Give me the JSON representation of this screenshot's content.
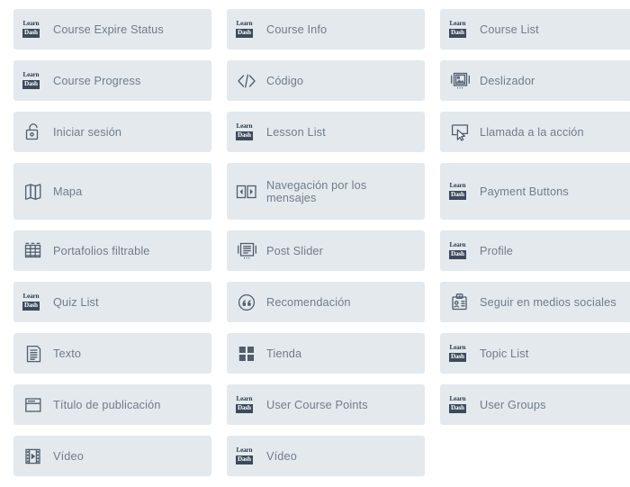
{
  "palette": {
    "page_background": "#ffffff",
    "card_background": "#e3e9ed",
    "label_color": "#6f7d8c",
    "icon_color": "#4f5d6e",
    "learndash_badge": "#3c4a5c"
  },
  "widgets": [
    [
      {
        "label": "Course Expire Status",
        "icon": "learndash-logo-icon",
        "tall": false
      },
      {
        "label": "Course Info",
        "icon": "learndash-logo-icon",
        "tall": false
      },
      {
        "label": "Course List",
        "icon": "learndash-logo-icon",
        "tall": false
      }
    ],
    [
      {
        "label": "Course Progress",
        "icon": "learndash-logo-icon",
        "tall": false
      },
      {
        "label": "Código",
        "icon": "code-icon",
        "tall": false
      },
      {
        "label": "Deslizador",
        "icon": "image-slider-icon",
        "tall": false
      }
    ],
    [
      {
        "label": "Iniciar sesión",
        "icon": "unlock-icon",
        "tall": false
      },
      {
        "label": "Lesson List",
        "icon": "learndash-logo-icon",
        "tall": false
      },
      {
        "label": "Llamada a la acción",
        "icon": "call-to-action-icon",
        "tall": false
      }
    ],
    [
      {
        "label": "Mapa",
        "icon": "map-icon",
        "tall": false
      },
      {
        "label": "Navegación por los mensajes",
        "icon": "post-navigation-icon",
        "tall": true
      },
      {
        "label": "Payment Buttons",
        "icon": "learndash-logo-icon",
        "tall": false
      }
    ],
    [
      {
        "label": "Portafolios filtrable",
        "icon": "grid-table-icon",
        "tall": false
      },
      {
        "label": "Post Slider",
        "icon": "post-slider-icon",
        "tall": false
      },
      {
        "label": "Profile",
        "icon": "learndash-logo-icon",
        "tall": false
      }
    ],
    [
      {
        "label": "Quiz List",
        "icon": "learndash-logo-icon",
        "tall": false
      },
      {
        "label": "Recomendación",
        "icon": "quote-icon",
        "tall": false
      },
      {
        "label": "Seguir en medios sociales",
        "icon": "contact-card-icon",
        "tall": false
      }
    ],
    [
      {
        "label": "Texto",
        "icon": "text-document-icon",
        "tall": false
      },
      {
        "label": "Tienda",
        "icon": "four-squares-icon",
        "tall": false
      },
      {
        "label": "Topic List",
        "icon": "learndash-logo-icon",
        "tall": false
      }
    ],
    [
      {
        "label": "Título de publicación",
        "icon": "window-title-icon",
        "tall": false
      },
      {
        "label": "User Course Points",
        "icon": "learndash-logo-icon",
        "tall": false
      },
      {
        "label": "User Groups",
        "icon": "learndash-logo-icon",
        "tall": false
      }
    ],
    [
      {
        "label": "Vídeo",
        "icon": "film-video-icon",
        "tall": false
      },
      {
        "label": "Vídeo",
        "icon": "learndash-logo-icon",
        "tall": false
      }
    ]
  ],
  "learndash_logo": {
    "top_text": "Learn",
    "bottom_text": "Dash"
  }
}
